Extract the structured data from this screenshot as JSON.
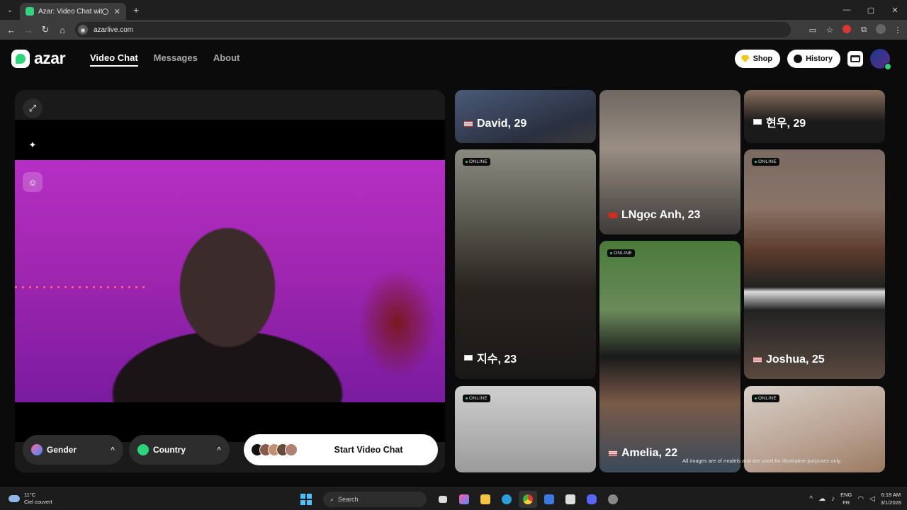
{
  "browser": {
    "tab_title": "Azar: Video Chat with New",
    "new_tab": "+",
    "url": "azarlive.com",
    "window_controls": [
      "—",
      "▢",
      "✕"
    ]
  },
  "header": {
    "logo_text": "azar",
    "nav": [
      "Video Chat",
      "Messages",
      "About"
    ],
    "shop_label": "Shop",
    "history_label": "History",
    "accent_color": "#2bd67b"
  },
  "video_chat": {
    "gender_label": "Gender",
    "country_label": "Country",
    "start_label": "Start Video Chat",
    "chevron": "^"
  },
  "cards": [
    {
      "name": "David, 29",
      "flag": "us",
      "online": false
    },
    {
      "name": "LNgọc Anh, 23",
      "flag": "vn",
      "online": false
    },
    {
      "name": "현우, 29",
      "flag": "kr",
      "online": false
    },
    {
      "name": "지수, 23",
      "flag": "kr",
      "online": true
    },
    {
      "name": "Amelia, 22",
      "flag": "us",
      "online": true
    },
    {
      "name": "Joshua, 25",
      "flag": "us",
      "online": true
    },
    {
      "name": "",
      "flag": "",
      "online": true
    },
    {
      "name": "",
      "flag": "",
      "online": true
    }
  ],
  "online_label": "ONLINE",
  "disclaimer": "All images are of models and are used for illustrative purposes only.",
  "taskbar": {
    "temp": "11°C",
    "weather": "Ciel couvert",
    "search": "Search",
    "lang_top": "ENG",
    "lang_bottom": "FR",
    "time": "6:18 AM",
    "date": "3/1/2026"
  }
}
